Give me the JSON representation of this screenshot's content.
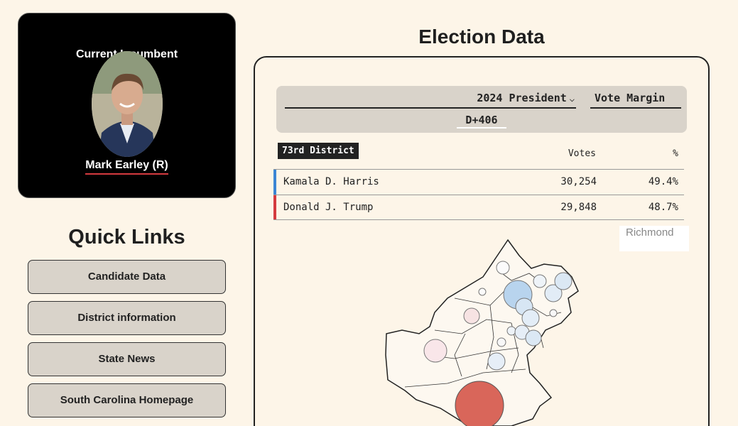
{
  "incumbent": {
    "heading": "Current Incumbent",
    "name": "Mark Earley (R)"
  },
  "quick_links": {
    "title": "Quick Links",
    "items": [
      {
        "label": "Candidate Data"
      },
      {
        "label": "District information"
      },
      {
        "label": "State News"
      },
      {
        "label": "South Carolina Homepage"
      }
    ]
  },
  "election": {
    "title": "Election Data",
    "race_select": "2024 President",
    "metric_select": "Vote Margin",
    "margin": "D+406",
    "district": "73rd District",
    "columns": {
      "votes": "Votes",
      "pct": "%"
    },
    "rows": [
      {
        "name": "Kamala D. Harris",
        "votes": "30,254",
        "pct": "49.4%",
        "color": "#3b86d4"
      },
      {
        "name": "Donald J. Trump",
        "votes": "29,848",
        "pct": "48.7%",
        "color": "#d43a3f"
      }
    ],
    "map_label": "Richmond"
  },
  "colors": {
    "background": "#fdf5e8",
    "button": "#d9d3ca",
    "democrat": "#3b86d4",
    "republican": "#d43a3f",
    "trump_bubble": "#d9665a"
  }
}
